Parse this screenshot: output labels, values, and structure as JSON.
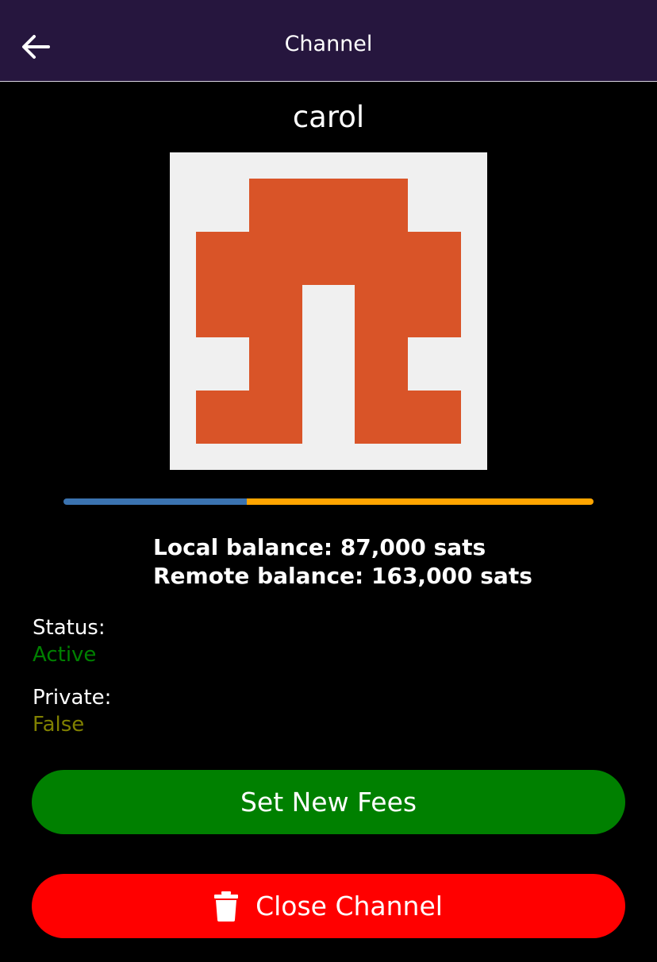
{
  "header": {
    "title": "Channel",
    "back_icon": "arrow-left-icon"
  },
  "peer": {
    "alias": "carol",
    "identicon": {
      "fg_color": "#d95428",
      "bg_color": "#f0f0f0"
    }
  },
  "balance_bar": {
    "local_fraction": 0.346,
    "local_color": "#3b73b0",
    "remote_color": "#ffa500"
  },
  "balances": {
    "local": "Local balance: 87,000 sats",
    "remote": "Remote balance: 163,000 sats"
  },
  "status": {
    "label": "Status:",
    "value": "Active",
    "color": "#008000"
  },
  "private": {
    "label": "Private:",
    "value": "False",
    "color": "#808000"
  },
  "buttons": {
    "set_fees": {
      "label": "Set New Fees",
      "color": "#008000"
    },
    "close_channel": {
      "label": "Close Channel",
      "color": "#ff0000",
      "icon": "trash-icon"
    }
  }
}
